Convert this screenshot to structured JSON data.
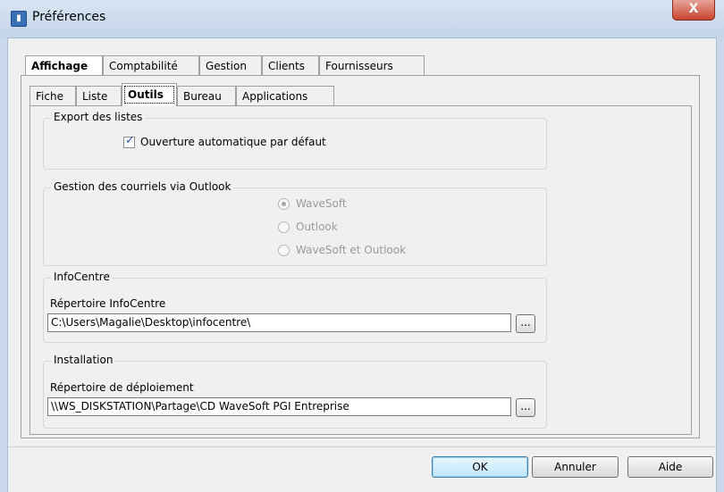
{
  "window": {
    "title": "Préférences",
    "close_label": "X"
  },
  "main_tabs": [
    "Affichage",
    "Comptabilité",
    "Gestion",
    "Clients",
    "Fournisseurs"
  ],
  "sub_tabs": [
    "Fiche",
    "Liste",
    "Outils",
    "Bureau",
    "Applications"
  ],
  "export": {
    "legend": "Export des listes",
    "checkbox_label": "Ouverture automatique par défaut",
    "checked": true
  },
  "courriels": {
    "legend": "Gestion des courriels  via Outlook",
    "options": [
      "WaveSoft",
      "Outlook",
      "WaveSoft et Outlook"
    ],
    "selected": "WaveSoft"
  },
  "infocentre": {
    "legend": "InfoCentre",
    "label": "Répertoire InfoCentre",
    "value": "C:\\Users\\Magalie\\Desktop\\infocentre\\",
    "browse": "..."
  },
  "installation": {
    "legend": "Installation",
    "label": "Répertoire de déploiement",
    "value": "\\\\WS_DISKSTATION\\Partage\\CD WaveSoft PGI Entreprise",
    "browse": "..."
  },
  "buttons": {
    "ok": "OK",
    "cancel": "Annuler",
    "help": "Aide"
  }
}
